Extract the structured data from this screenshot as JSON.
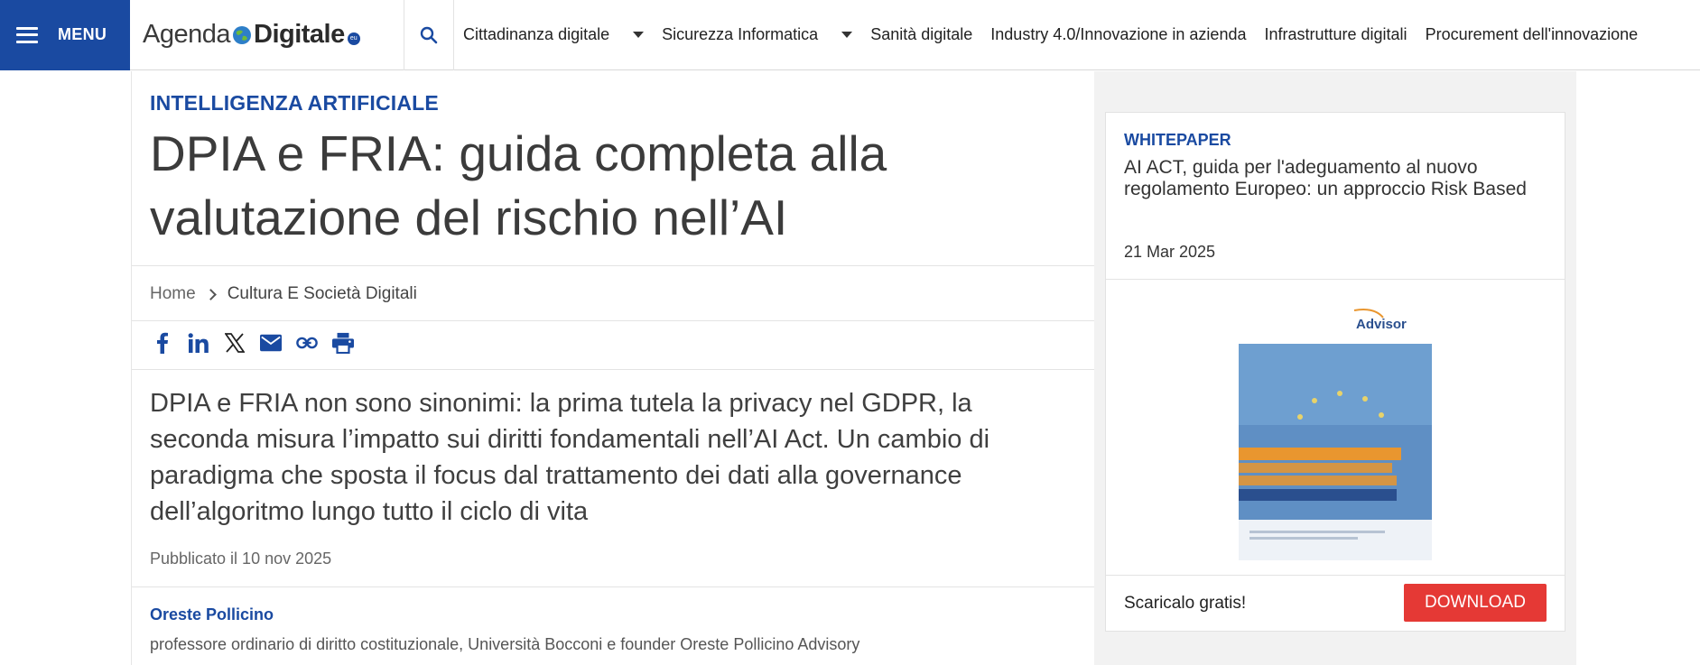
{
  "header": {
    "menu_label": "MENU",
    "logo": {
      "part1": "Agenda",
      "part2": "Digitale",
      "suffix": "eu"
    },
    "nav": [
      {
        "label": "Cittadinanza digitale",
        "has_dropdown": true
      },
      {
        "label": "Sicurezza Informatica",
        "has_dropdown": true
      },
      {
        "label": "Sanità digitale",
        "has_dropdown": false
      },
      {
        "label": "Industry 4.0/Innovazione in azienda",
        "has_dropdown": false
      },
      {
        "label": "Infrastrutture digitali",
        "has_dropdown": false
      },
      {
        "label": "Procurement dell'innovazione",
        "has_dropdown": false
      }
    ],
    "icons": {
      "menu": "hamburger-icon",
      "search": "search-icon",
      "dropdown": "caret-down-icon"
    }
  },
  "article": {
    "kicker": "INTELLIGENZA ARTIFICIALE",
    "title": "DPIA e FRIA: guida completa alla valutazione del rischio nell’AI",
    "breadcrumb": {
      "home": "Home",
      "section": "Cultura E Società Digitali"
    },
    "share_icons": [
      "facebook-icon",
      "linkedin-icon",
      "x-icon",
      "email-icon",
      "link-icon",
      "print-icon"
    ],
    "summary": "DPIA e FRIA non sono sinonimi: la prima tutela la privacy nel GDPR, la seconda misura l’impatto sui diritti fondamentali nell’AI Act. Un cambio di paradigma che sposta il focus dal trattamento dei dati alla governance dell’algoritmo lungo tutto il ciclo di vita",
    "published": "Pubblicato il 10 nov 2025",
    "author": "Oreste Pollicino",
    "author_role": "professore ordinario di diritto costituzionale, Università Bocconi e founder Oreste Pollicino Advisory"
  },
  "sidebar": {
    "whitepaper": {
      "label": "WHITEPAPER",
      "title": "AI ACT, guida per l'adeguamento al nuovo regolamento Europeo: un approccio Risk Based",
      "date": "21 Mar 2025",
      "cover_brand": "Advisor",
      "cta": "Scaricalo gratis!",
      "download_label": "DOWNLOAD"
    }
  },
  "colors": {
    "brand_blue": "#1a4aa1",
    "download_red": "#e53935",
    "sidebar_bg": "#f2f2f2"
  }
}
